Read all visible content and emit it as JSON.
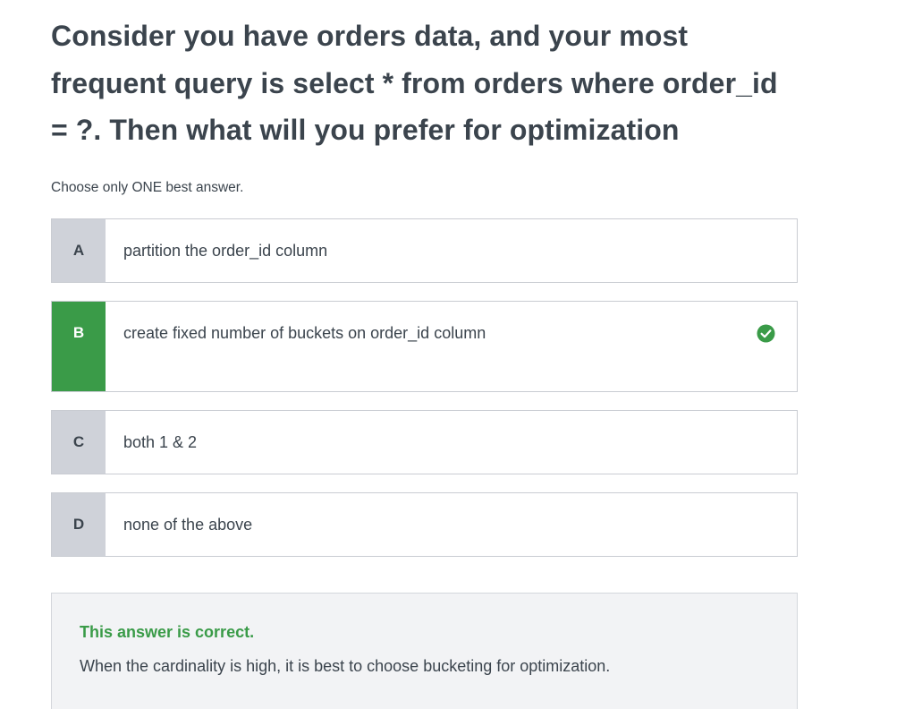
{
  "question": {
    "text": "Consider you have orders data, and your most frequent query is select * from orders where order_id = ?. Then what will you prefer for optimization"
  },
  "instruction": "Choose only ONE best answer.",
  "options": [
    {
      "letter": "A",
      "text": "partition the order_id column",
      "selected": false
    },
    {
      "letter": "B",
      "text": "create fixed number of buckets on order_id column",
      "selected": true,
      "correct": true
    },
    {
      "letter": "C",
      "text": "both 1 & 2",
      "selected": false
    },
    {
      "letter": "D",
      "text": "none of the above",
      "selected": false
    }
  ],
  "feedback": {
    "status": "This answer is correct.",
    "explanation": "When the cardinality is high, it is best to choose bucketing for optimization."
  },
  "colors": {
    "correct": "#3a9b48",
    "letter_bg": "#cfd2d9",
    "text": "#3b444d",
    "feedback_bg": "#f2f3f5"
  },
  "icons": {
    "correct_marker": "check-circle-icon"
  }
}
